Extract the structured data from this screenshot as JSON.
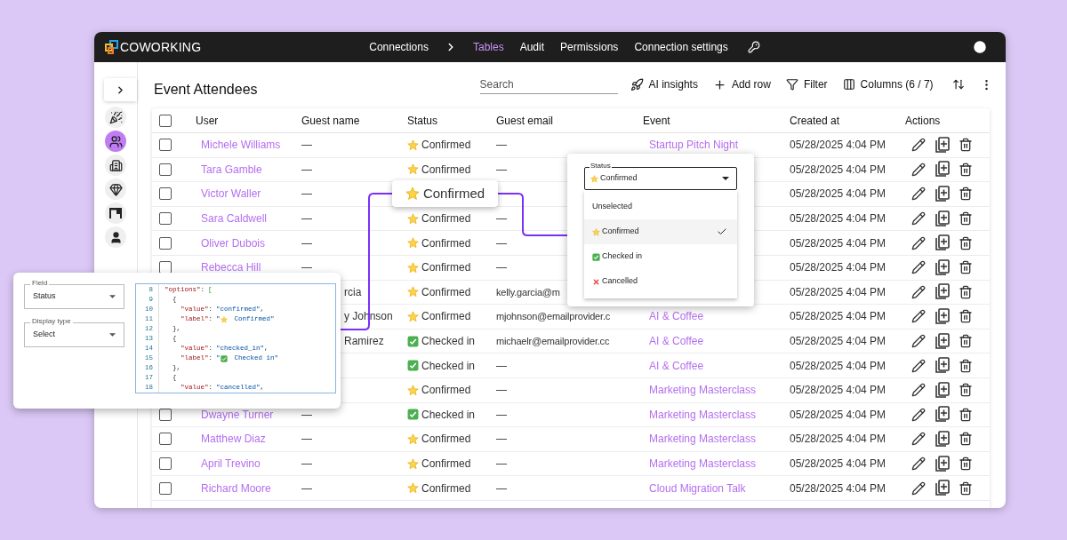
{
  "brand": {
    "name": "COWORKING"
  },
  "nav": [
    {
      "label": "Connections",
      "selected": false,
      "kind": "crumb"
    },
    {
      "label": "Tables",
      "selected": true,
      "kind": "link"
    },
    {
      "label": "Audit",
      "selected": false,
      "kind": "link"
    },
    {
      "label": "Permissions",
      "selected": false,
      "kind": "link"
    },
    {
      "label": "Connection settings",
      "selected": false,
      "kind": "link"
    }
  ],
  "sidebar": {
    "items": [
      {
        "selected": false
      },
      {
        "selected": true
      },
      {
        "selected": false
      },
      {
        "selected": false
      },
      {
        "selected": false
      },
      {
        "selected": false
      }
    ]
  },
  "page_title": "Event Attendees",
  "search": {
    "placeholder": "Search"
  },
  "toolbar": [
    {
      "kind": "ai",
      "label": "AI insights"
    },
    {
      "kind": "add",
      "label": "Add row"
    },
    {
      "kind": "filter",
      "label": "Filter"
    },
    {
      "kind": "columns",
      "label": "Columns (6 / 7)"
    }
  ],
  "table": {
    "select_all": {
      "checked": false
    },
    "columns": [
      "User",
      "Guest name",
      "Status",
      "Guest email",
      "Event",
      "Created at",
      "Actions"
    ],
    "rows": [
      {
        "checked": false,
        "user": "Michele Williams",
        "guest_name": "—",
        "status": {
          "kind": "confirmed",
          "label": "Confirmed"
        },
        "guest_email": "—",
        "event": "Startup Pitch Night",
        "created_at": "05/28/2025 4:04 PM"
      },
      {
        "checked": false,
        "user": "Tara Gamble",
        "guest_name": "—",
        "status": {
          "kind": "confirmed",
          "label": "Confirmed"
        },
        "guest_email": "—",
        "created_at": "05/28/2025 4:04 PM"
      },
      {
        "checked": false,
        "user": "Victor Waller",
        "guest_name": "—",
        "created_at": "05/28/2025 4:04 PM"
      },
      {
        "checked": false,
        "user": "Sara Caldwell",
        "guest_name": "—",
        "status": {
          "kind": "confirmed",
          "label": "Confirmed"
        },
        "guest_email": "—",
        "created_at": "05/28/2025 4:04 PM"
      },
      {
        "checked": false,
        "user": "Oliver Dubois",
        "guest_name": "—",
        "status": {
          "kind": "confirmed",
          "label": "Confirmed"
        },
        "guest_email": "—",
        "created_at": "05/28/2025 4:04 PM"
      },
      {
        "checked": false,
        "user": "Rebecca Hill",
        "guest_name": "—",
        "status": {
          "kind": "confirmed",
          "label": "Confirmed"
        },
        "guest_email": "—",
        "created_at": "05/28/2025 4:04 PM"
      },
      {
        "guest_name": "rcia",
        "guest_name_clipped": true,
        "status": {
          "kind": "confirmed",
          "label": "Confirmed"
        },
        "guest_email": "kelly.garcia@m",
        "created_at": "05/28/2025 4:04 PM"
      },
      {
        "guest_name": "y Johnson",
        "guest_name_clipped": true,
        "status": {
          "kind": "confirmed",
          "label": "Confirmed"
        },
        "guest_email": "mjohnson@emailprovider.c",
        "event": "AI & Coffee",
        "created_at": "05/28/2025 4:04 PM"
      },
      {
        "guest_name": "Ramirez",
        "guest_name_clipped": true,
        "status": {
          "kind": "checked_in",
          "label": "Checked in"
        },
        "guest_email": "michaelr@emailprovider.cc",
        "event": "AI & Coffee",
        "created_at": "05/28/2025 4:04 PM"
      },
      {
        "status": {
          "kind": "checked_in",
          "label": "Checked in"
        },
        "guest_email": "—",
        "event": "AI & Coffee",
        "created_at": "05/28/2025 4:04 PM"
      },
      {
        "status": {
          "kind": "confirmed",
          "label": "Confirmed"
        },
        "guest_email": "—",
        "event": "Marketing Masterclass",
        "created_at": "05/28/2025 4:04 PM"
      },
      {
        "checked": false,
        "user": "Dwayne Turner",
        "guest_name": "—",
        "status": {
          "kind": "checked_in",
          "label": "Checked in"
        },
        "guest_email": "—",
        "event": "Marketing Masterclass",
        "created_at": "05/28/2025 4:04 PM"
      },
      {
        "checked": false,
        "user": "Matthew Diaz",
        "guest_name": "—",
        "status": {
          "kind": "confirmed",
          "label": "Confirmed"
        },
        "guest_email": "—",
        "event": "Marketing Masterclass",
        "created_at": "05/28/2025 4:04 PM"
      },
      {
        "checked": false,
        "user": "April Trevino",
        "guest_name": "—",
        "status": {
          "kind": "confirmed",
          "label": "Confirmed"
        },
        "guest_email": "—",
        "event": "Marketing Masterclass",
        "created_at": "05/28/2025 4:04 PM"
      },
      {
        "checked": false,
        "user": "Richard Moore",
        "guest_name": "—",
        "status": {
          "kind": "confirmed",
          "label": "Confirmed"
        },
        "guest_email": "—",
        "event": "Cloud Migration Talk",
        "created_at": "05/28/2025 4:04 PM"
      }
    ]
  },
  "callout": {
    "kind": "confirmed",
    "label": "Confirmed"
  },
  "status_dropdown": {
    "label": "Status",
    "value": {
      "kind": "confirmed",
      "label": "Confirmed"
    },
    "options": [
      {
        "kind": "none",
        "label": "Unselected",
        "selected": false
      },
      {
        "kind": "confirmed",
        "label": "Confirmed",
        "selected": true
      },
      {
        "kind": "checked_in",
        "label": "Checked in",
        "selected": false
      },
      {
        "kind": "cancelled",
        "label": "Cancelled",
        "selected": false
      }
    ]
  },
  "field_settings": {
    "field": {
      "label": "Field",
      "value": "Status"
    },
    "display_type": {
      "label": "Display type",
      "value": "Select"
    },
    "code": [
      {
        "num": "8",
        "tokens": [
          {
            "kind": "key",
            "text": "\"options\""
          },
          {
            "kind": "punct",
            "text": ":"
          },
          {
            "kind": "bracket",
            "text": "["
          }
        ]
      },
      {
        "num": "9",
        "tokens": [
          {
            "kind": "punct",
            "text": "{",
            "nested": true
          }
        ]
      },
      {
        "num": "10",
        "tokens": [
          {
            "kind": "key",
            "text": "\"value\"",
            "nested": true,
            "inner": true
          },
          {
            "kind": "punct",
            "text": ":"
          },
          {
            "kind": "str",
            "text": "\"confirmed\""
          },
          {
            "kind": "comma",
            "text": ","
          }
        ]
      },
      {
        "num": "11",
        "tokens": [
          {
            "kind": "key",
            "text": "\"label\"",
            "nested": true,
            "inner": true
          },
          {
            "kind": "punct",
            "text": ":"
          },
          {
            "kind": "str",
            "text": "\""
          },
          {
            "kind": "confirmed"
          },
          {
            "kind": "str",
            "text": "Confirmed\""
          }
        ]
      },
      {
        "num": "12",
        "tokens": [
          {
            "kind": "punct",
            "text": "},",
            "nested": true
          }
        ]
      },
      {
        "num": "13",
        "tokens": [
          {
            "kind": "punct",
            "text": "{",
            "nested": true
          }
        ]
      },
      {
        "num": "14",
        "tokens": [
          {
            "kind": "key",
            "text": "\"value\"",
            "nested": true,
            "inner": true
          },
          {
            "kind": "punct",
            "text": ":"
          },
          {
            "kind": "str",
            "text": "\"checked_in\""
          },
          {
            "kind": "comma",
            "text": ","
          }
        ]
      },
      {
        "num": "15",
        "tokens": [
          {
            "kind": "key",
            "text": "\"label\"",
            "nested": true,
            "inner": true
          },
          {
            "kind": "punct",
            "text": ":"
          },
          {
            "kind": "str",
            "text": "\""
          },
          {
            "kind": "checked_in"
          },
          {
            "kind": "str",
            "text": "Checked in\""
          }
        ]
      },
      {
        "num": "16",
        "tokens": [
          {
            "kind": "punct",
            "text": "},",
            "nested": true
          }
        ]
      },
      {
        "num": "17",
        "tokens": [
          {
            "kind": "punct",
            "text": "{",
            "nested": true
          }
        ]
      },
      {
        "num": "18",
        "tokens": [
          {
            "kind": "key",
            "text": "\"value\"",
            "nested": true,
            "inner": true
          },
          {
            "kind": "punct",
            "text": ":"
          },
          {
            "kind": "str",
            "text": "\"cancelled\""
          },
          {
            "kind": "comma",
            "text": ","
          }
        ]
      }
    ]
  }
}
